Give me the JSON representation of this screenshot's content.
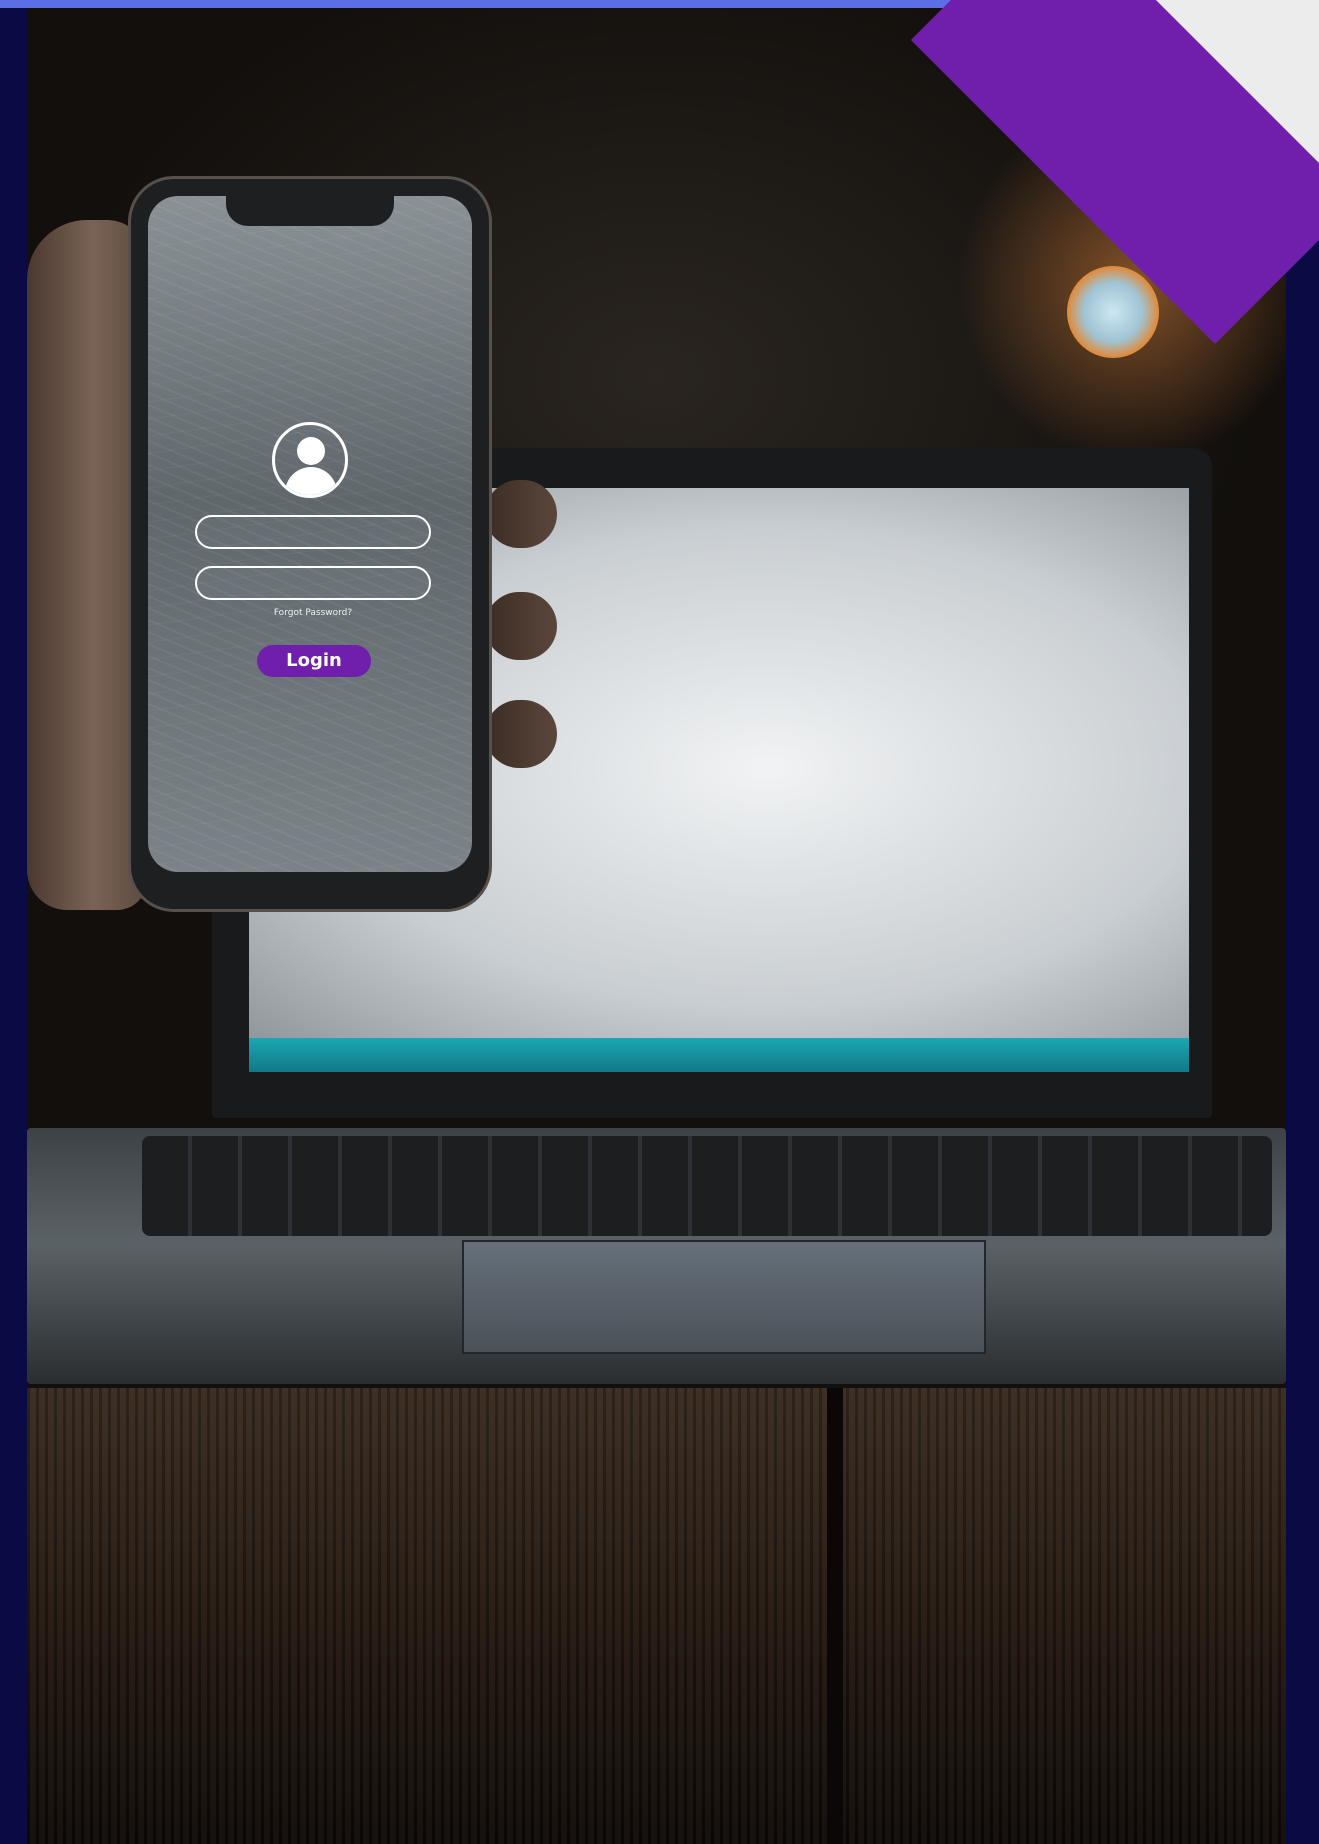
{
  "login": {
    "forgot_password": "Forgot Password?",
    "button": "Login",
    "username_value": "",
    "password_value": ""
  },
  "colors": {
    "accent_purple": "#6f1fab",
    "frame_navy": "#0a0a44",
    "top_bar": "#5b6ee6",
    "corner_light": "#ececec"
  },
  "icons": [
    "user-avatar-icon"
  ]
}
